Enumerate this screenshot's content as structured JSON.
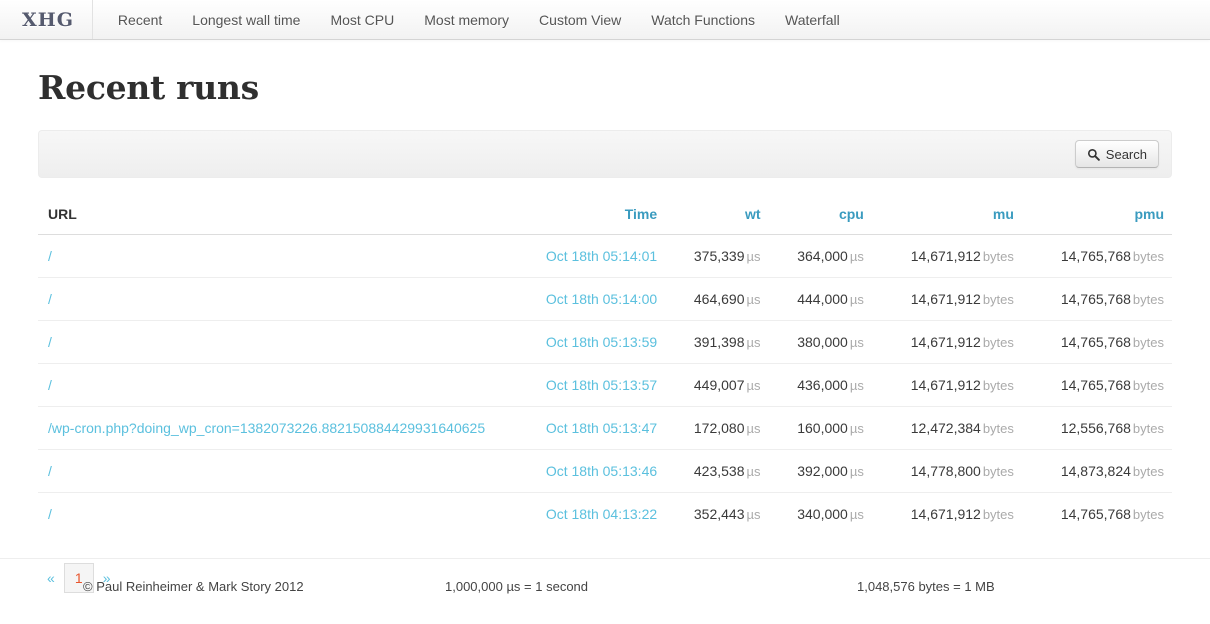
{
  "navbar": {
    "brand": "XHG",
    "items": [
      {
        "label": "Recent"
      },
      {
        "label": "Longest wall time"
      },
      {
        "label": "Most CPU"
      },
      {
        "label": "Most memory"
      },
      {
        "label": "Custom View"
      },
      {
        "label": "Watch Functions"
      },
      {
        "label": "Waterfall"
      }
    ]
  },
  "page": {
    "title": "Recent runs"
  },
  "search": {
    "button_label": "Search",
    "icon": "search-icon"
  },
  "table": {
    "headers": {
      "url": "URL",
      "time": "Time",
      "wt": "wt",
      "cpu": "cpu",
      "mu": "mu",
      "pmu": "pmu"
    },
    "units": {
      "micro": "µs",
      "bytes": "bytes"
    },
    "rows": [
      {
        "url": "/",
        "time": "Oct 18th 05:14:01",
        "wt": "375,339",
        "cpu": "364,000",
        "mu": "14,671,912",
        "pmu": "14,765,768"
      },
      {
        "url": "/",
        "time": "Oct 18th 05:14:00",
        "wt": "464,690",
        "cpu": "444,000",
        "mu": "14,671,912",
        "pmu": "14,765,768"
      },
      {
        "url": "/",
        "time": "Oct 18th 05:13:59",
        "wt": "391,398",
        "cpu": "380,000",
        "mu": "14,671,912",
        "pmu": "14,765,768"
      },
      {
        "url": "/",
        "time": "Oct 18th 05:13:57",
        "wt": "449,007",
        "cpu": "436,000",
        "mu": "14,671,912",
        "pmu": "14,765,768"
      },
      {
        "url": "/wp-cron.php?doing_wp_cron=1382073226.882150884429931640625",
        "time": "Oct 18th 05:13:47",
        "wt": "172,080",
        "cpu": "160,000",
        "mu": "12,472,384",
        "pmu": "12,556,768"
      },
      {
        "url": "/",
        "time": "Oct 18th 05:13:46",
        "wt": "423,538",
        "cpu": "392,000",
        "mu": "14,778,800",
        "pmu": "14,873,824"
      },
      {
        "url": "/",
        "time": "Oct 18th 04:13:22",
        "wt": "352,443",
        "cpu": "340,000",
        "mu": "14,671,912",
        "pmu": "14,765,768"
      }
    ]
  },
  "pagination": {
    "prev": "«",
    "next": "»",
    "pages": [
      {
        "label": "1",
        "active": true
      }
    ]
  },
  "footer": {
    "copyright": "© Paul Reinheimer & Mark Story 2012",
    "time_note": "1,000,000 µs = 1 second",
    "bytes_note": "1,048,576 bytes = 1 MB"
  },
  "colors": {
    "link": "#5bc0de",
    "header_link": "#3a9bbf",
    "active_page": "#e8552d",
    "brand": "#555a6e"
  }
}
